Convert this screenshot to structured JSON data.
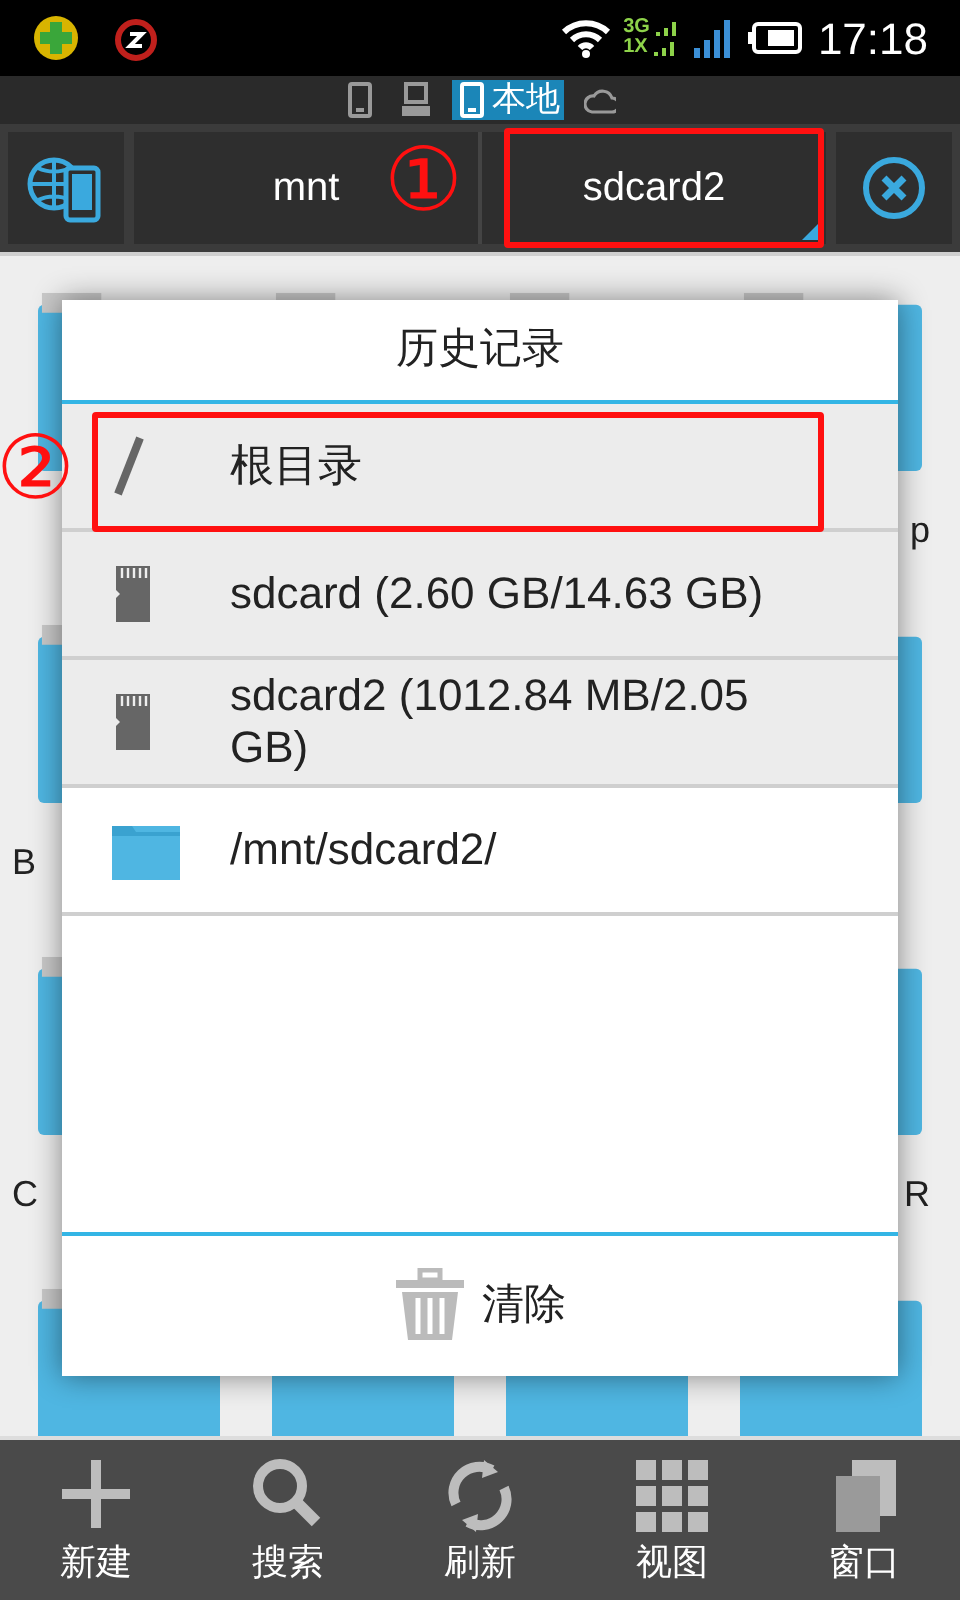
{
  "status_bar": {
    "network_top": "3G",
    "network_bottom": "1X",
    "time": "17:18"
  },
  "storage_tabs": [
    {
      "kind": "phone",
      "selected": false
    },
    {
      "kind": "computer",
      "selected": false
    },
    {
      "kind": "local",
      "label": "本地",
      "selected": true
    },
    {
      "kind": "cloud",
      "selected": false
    }
  ],
  "breadcrumbs": [
    {
      "label": "mnt",
      "selected": false
    },
    {
      "label": "sdcard2",
      "selected": true
    }
  ],
  "background_labels": [
    "p",
    "B",
    "C",
    "R"
  ],
  "dialog": {
    "title": "历史记录",
    "items": [
      {
        "kind": "root",
        "label": "根目录"
      },
      {
        "kind": "sdcard",
        "label": "sdcard (2.60 GB/14.63 GB)"
      },
      {
        "kind": "sdcard",
        "label": "sdcard2 (1012.84 MB/2.05 GB)"
      },
      {
        "kind": "folder",
        "label": "/mnt/sdcard2/"
      }
    ],
    "clear_button": "清除"
  },
  "annotations": [
    "①",
    "②"
  ],
  "toolbar": [
    {
      "kind": "plus",
      "label": "新建"
    },
    {
      "kind": "search",
      "label": "搜索"
    },
    {
      "kind": "refresh",
      "label": "刷新"
    },
    {
      "kind": "grid",
      "label": "视图"
    },
    {
      "kind": "windows",
      "label": "窗口"
    }
  ]
}
